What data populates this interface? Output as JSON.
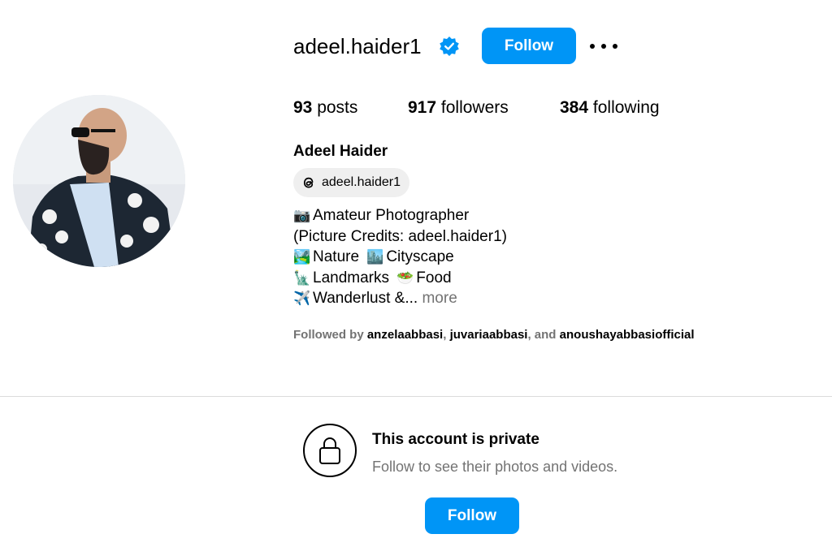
{
  "profile": {
    "username": "adeel.haider1",
    "verified_icon": "verified-badge-icon",
    "follow_label": "Follow",
    "more_icon": "more-options-icon",
    "stats": {
      "posts_count": "93",
      "posts_label": "posts",
      "followers_count": "917",
      "followers_label": "followers",
      "following_count": "384",
      "following_label": "following"
    },
    "full_name": "Adeel Haider",
    "threads_handle": "adeel.haider1",
    "bio": {
      "line1_emoji": "📷",
      "line1_text": "Amateur Photographer",
      "line2_text": "(Picture Credits: adeel.haider1)",
      "line3_emoji_a": "🏞️",
      "line3_text_a": "Nature",
      "line3_emoji_b": "🏙️",
      "line3_text_b": "Cityscape",
      "line4_emoji_a": "🗽",
      "line4_text_a": "Landmarks",
      "line4_emoji_b": "🥗",
      "line4_text_b": "Food",
      "line5_emoji": "✈️",
      "line5_text": "Wanderlust &...",
      "more_label": "more"
    },
    "followed_by": {
      "prefix": "Followed by",
      "account1": "anzelaabbasi",
      "sep1": ",",
      "account2": "juvariaabbasi",
      "sep2": ", and",
      "account3": "anoushayabbasiofficial"
    }
  },
  "private_section": {
    "title": "This account is private",
    "subtitle": "Follow to see their photos and videos.",
    "follow_label": "Follow"
  },
  "colors": {
    "accent": "#0095f6",
    "verified": "#0095f6",
    "secondary_text": "#737373",
    "divider": "#dbdbdb",
    "chip_bg": "#efefef"
  }
}
